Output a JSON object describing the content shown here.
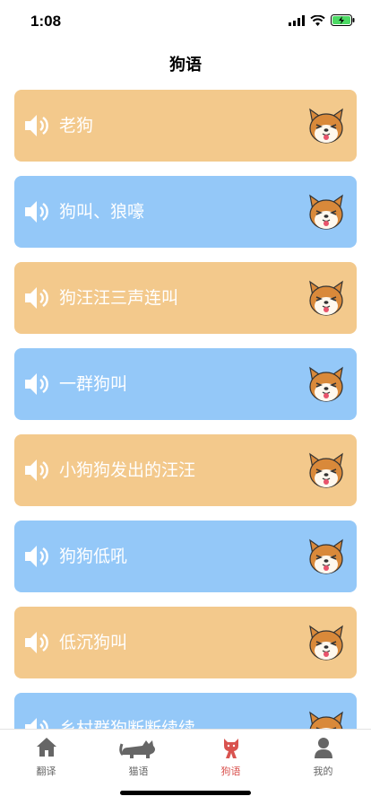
{
  "status": {
    "time": "1:08"
  },
  "page": {
    "title": "狗语"
  },
  "items": [
    {
      "label": "老狗",
      "color": "orange"
    },
    {
      "label": "狗叫、狼嚎",
      "color": "blue"
    },
    {
      "label": "狗汪汪三声连叫",
      "color": "orange"
    },
    {
      "label": "一群狗叫",
      "color": "blue"
    },
    {
      "label": "小狗狗发出的汪汪",
      "color": "orange"
    },
    {
      "label": "狗狗低吼",
      "color": "blue"
    },
    {
      "label": "低沉狗叫",
      "color": "orange"
    },
    {
      "label": "乡村群狗断断续续",
      "color": "blue"
    }
  ],
  "colors": {
    "orange": "#F3C98C",
    "blue": "#94C8F8",
    "active_tab": "#D9534F"
  },
  "tabs": [
    {
      "label": "翻译",
      "icon": "home-icon"
    },
    {
      "label": "猫语",
      "icon": "cat-icon"
    },
    {
      "label": "狗语",
      "icon": "dog-icon",
      "active": true
    },
    {
      "label": "我的",
      "icon": "user-icon"
    }
  ]
}
